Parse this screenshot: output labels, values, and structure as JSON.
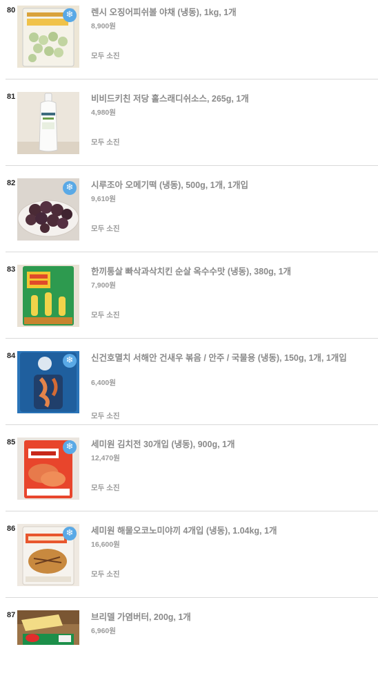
{
  "products": [
    {
      "rank": "80",
      "name": "렌시 오징어피쉬볼 야채 (냉동), 1kg, 1개",
      "price": "8,900원",
      "status": "모두 소진",
      "frozen": true,
      "image": "fishball-pack"
    },
    {
      "rank": "81",
      "name": "비비드키친 저당 홀스래디쉬소스, 265g, 1개",
      "price": "4,980원",
      "status": "모두 소진",
      "frozen": false,
      "image": "sauce-bottle"
    },
    {
      "rank": "82",
      "name": "시루조아 오메기떡 (냉동), 500g, 1개, 1개입",
      "price": "9,610원",
      "status": "모두 소진",
      "frozen": true,
      "image": "rice-cake-plate"
    },
    {
      "rank": "83",
      "name": "한끼통살 빠삭과삭치킨 순살 옥수수맛 (냉동), 380g, 1개",
      "price": "7,900원",
      "status": "모두 소진",
      "frozen": false,
      "image": "chicken-pack"
    },
    {
      "rank": "84",
      "name": "신건호멸치 서해안 건새우 볶음 / 안주 / 국물용 (냉동), 150g, 1개, 1개입",
      "price": "6,400원",
      "status": "모두 소진",
      "frozen": true,
      "image": "shrimp-pack"
    },
    {
      "rank": "85",
      "name": "세미원 김치전 30개입 (냉동), 900g, 1개",
      "price": "12,470원",
      "status": "모두 소진",
      "frozen": true,
      "image": "kimchi-pancake-pack"
    },
    {
      "rank": "86",
      "name": "세미원 해물오코노미야끼 4개입 (냉동), 1.04kg, 1개",
      "price": "16,600원",
      "status": "모두 소진",
      "frozen": true,
      "image": "okonomiyaki-pack"
    },
    {
      "rank": "87",
      "name": "브리델 가염버터, 200g, 1개",
      "price": "6,960원",
      "status": "",
      "frozen": false,
      "image": "butter-block"
    }
  ],
  "icons": {
    "frozen_badge": "snowflake-icon"
  },
  "colors": {
    "text_muted": "#8a8a8a",
    "divider": "#d9d9d9",
    "frozen_badge": "#5aa9e6"
  }
}
